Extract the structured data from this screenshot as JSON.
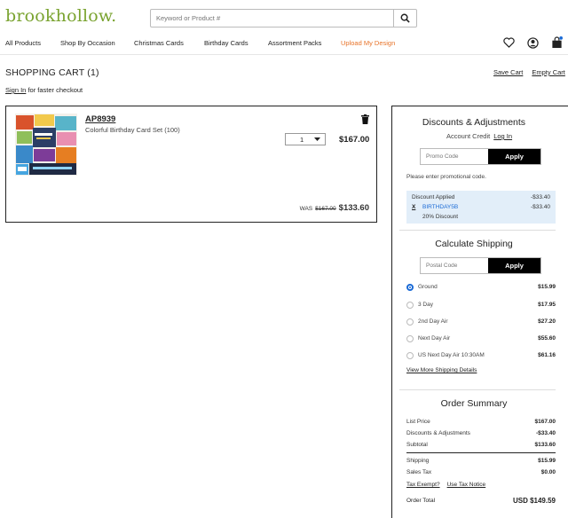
{
  "header": {
    "logo": "brookhollow.",
    "search_placeholder": "Keyword or Product #"
  },
  "nav": {
    "items": [
      "All Products",
      "Shop By Occasion",
      "Christmas Cards",
      "Birthday Cards",
      "Assortment Packs",
      "Upload My Design"
    ],
    "highlight_color": "#e8742a"
  },
  "cart": {
    "title": "SHOPPING CART (1)",
    "signin_link": "Sign In",
    "signin_suffix": " for faster checkout",
    "save_cart": "Save Cart",
    "empty_cart": "Empty Cart"
  },
  "item": {
    "sku": "AP8939",
    "description": "Colorful Birthday Card Set (100)",
    "quantity": "1",
    "price": "$167.00",
    "was_label": "WAS",
    "was_price": "$167.00",
    "now_price": "$133.60"
  },
  "discounts": {
    "title": "Discounts & Adjustments",
    "account_credit": "Account Credit",
    "login": "Log In",
    "promo_placeholder": "Promo Code",
    "apply": "Apply",
    "hint": "Please enter promotional code.",
    "applied_label": "Discount Applied",
    "applied_amount": "-$33.40",
    "code": "BIRTHDAY5B",
    "code_amount": "-$33.40",
    "code_desc": "20% Discount",
    "remove": "X"
  },
  "shipping": {
    "title": "Calculate Shipping",
    "postal_placeholder": "Postal Code",
    "apply": "Apply",
    "options": [
      {
        "label": "Ground",
        "price": "$15.99",
        "selected": true
      },
      {
        "label": "3 Day",
        "price": "$17.95",
        "selected": false
      },
      {
        "label": "2nd Day Air",
        "price": "$27.20",
        "selected": false
      },
      {
        "label": "Next Day Air",
        "price": "$55.60",
        "selected": false
      },
      {
        "label": "US Next Day Air 10:30AM",
        "price": "$61.16",
        "selected": false
      }
    ],
    "more": "View More Shipping Details"
  },
  "summary": {
    "title": "Order Summary",
    "list_price_label": "List Price",
    "list_price": "$167.00",
    "disc_label": "Discounts & Adjustments",
    "disc": "-$33.40",
    "subtotal_label": "Subtotal",
    "subtotal": "$133.60",
    "shipping_label": "Shipping",
    "shipping": "$15.99",
    "tax_label": "Sales Tax",
    "tax": "$0.00",
    "tax_exempt": "Tax Exempt?",
    "tax_notice": "Use Tax Notice",
    "total_label": "Order Total",
    "total": "USD $149.59"
  }
}
